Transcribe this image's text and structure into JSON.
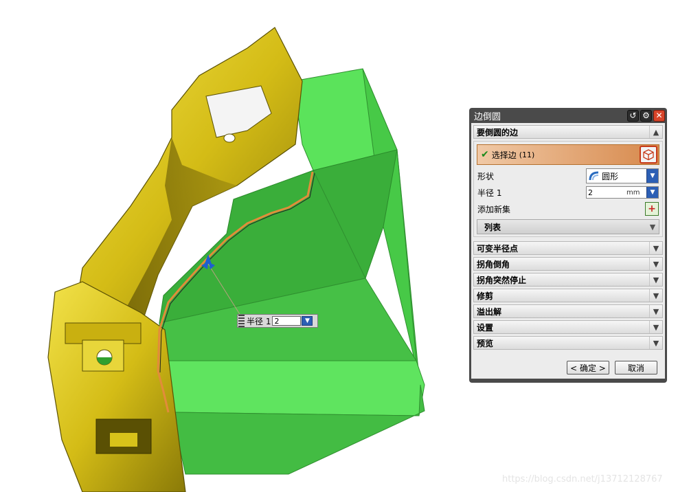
{
  "float_input": {
    "label": "半径 1",
    "value": "2"
  },
  "dialog": {
    "title": "边倒圆",
    "section_edges": {
      "header": "要倒圆的边",
      "select_edge": {
        "label": "选择边",
        "count": "(11)"
      },
      "shape": {
        "label": "形状",
        "value": "圆形"
      },
      "radius": {
        "label": "半径 1",
        "value": "2",
        "unit": "mm"
      },
      "add_new_set": "添加新集",
      "list_header": "列表"
    },
    "sections": [
      "可变半径点",
      "拐角倒角",
      "拐角突然停止",
      "修剪",
      "溢出解",
      "设置",
      "预览"
    ],
    "ok_label": "< 确定 >",
    "cancel_label": "取消"
  },
  "watermark": "https://blog.csdn.net/j13712128767",
  "colors": {
    "part_yellow": "#d8c21a",
    "part_green": "#4ccf4c",
    "selection_orange": "#d7894c",
    "dialog_frame": "#4a4a4a"
  }
}
